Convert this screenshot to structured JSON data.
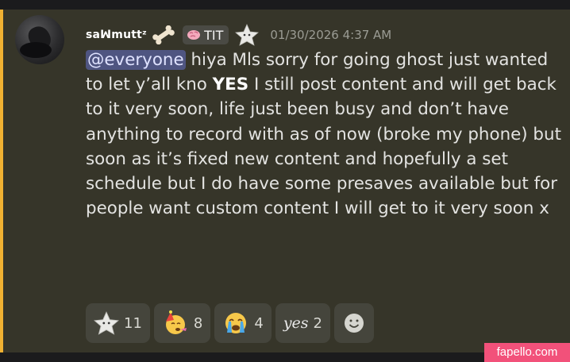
{
  "message": {
    "username": "saꟽmuttᶻ",
    "role_tag": "TIT",
    "timestamp": "01/30/2026 4:37 AM",
    "mention": "@everyone",
    "text_part1": " hiya Mls sorry for going ghost just wanted to let y’all kno ",
    "text_bold": "YES",
    "text_part2": " I still post content and will get back to it very soon, life just been busy and don’t have anything to record with as of now (broke my phone) but soon as it’s fixed new content and hopefully a set schedule but I do have some presaves available but for people want custom content I will get to it very soon x"
  },
  "reactions": [
    {
      "icon": "star-face-icon",
      "count": "11"
    },
    {
      "icon": "party-face-icon",
      "count": "8"
    },
    {
      "icon": "crying-face-icon",
      "count": "4"
    },
    {
      "icon": "yes-text-icon",
      "glyph": "yes",
      "count": "2"
    }
  ],
  "watermark": "fapello.com",
  "colors": {
    "mention_bar": "#f0b132",
    "mention_highlight": "#4f5581",
    "watermark_bg": "#f2517a"
  }
}
